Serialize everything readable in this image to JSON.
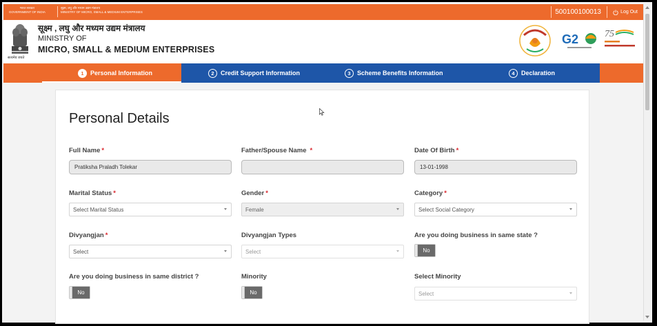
{
  "topbar": {
    "govt_hindi": "भारत सरकार",
    "govt_en": "GOVERNMENT OF INDIA",
    "ministry_hindi_small": "सूक्ष्म, लघु और मध्यम उद्यम मंत्रालय",
    "ministry_en_small": "MINISTRY OF MICRO, SMALL & MEDIUM ENTERPRISES",
    "udyam_number": "500100100013",
    "logout_label": "Log Out"
  },
  "header": {
    "ministry_hindi": "सूक्ष्म , लघु और मध्यम उद्यम मंत्रालय",
    "ministry_of": "MINISTRY OF",
    "ministry_name": "MICRO, SMALL & MEDIUM ENTERPRISES",
    "emblem_caption": "सत्यमेव जयते"
  },
  "steps": [
    {
      "num": "1",
      "label": "Personal Information",
      "active": true
    },
    {
      "num": "2",
      "label": "Credit Support Information",
      "active": false
    },
    {
      "num": "3",
      "label": "Scheme Benefits Information",
      "active": false
    },
    {
      "num": "4",
      "label": "Declaration",
      "active": false
    }
  ],
  "form": {
    "title": "Personal Details",
    "full_name": {
      "label": "Full Name",
      "value": "Pratiksha Praladh Tolekar"
    },
    "father_name": {
      "label": "Father/Spouse Name",
      "value": ""
    },
    "dob": {
      "label": "Date Of Birth",
      "value": "13-01-1998"
    },
    "marital_status": {
      "label": "Marital Status",
      "value": "Select Marital Status"
    },
    "gender": {
      "label": "Gender",
      "value": "Female"
    },
    "category": {
      "label": "Category",
      "value": "Select Social Category"
    },
    "divyangjan": {
      "label": "Divyangjan",
      "value": "Select"
    },
    "divyangjan_types": {
      "label": "Divyangjan Types",
      "value": "Select"
    },
    "same_state": {
      "label": "Are you doing business in same state ?",
      "value": "No"
    },
    "same_district": {
      "label": "Are you doing business in same district ?",
      "value": "No"
    },
    "minority": {
      "label": "Minority",
      "value": "No"
    },
    "select_minority": {
      "label": "Select Minority",
      "value": "Select"
    }
  },
  "colors": {
    "orange": "#ed6a2c",
    "blue": "#1e56a8",
    "required": "#d9262d"
  }
}
